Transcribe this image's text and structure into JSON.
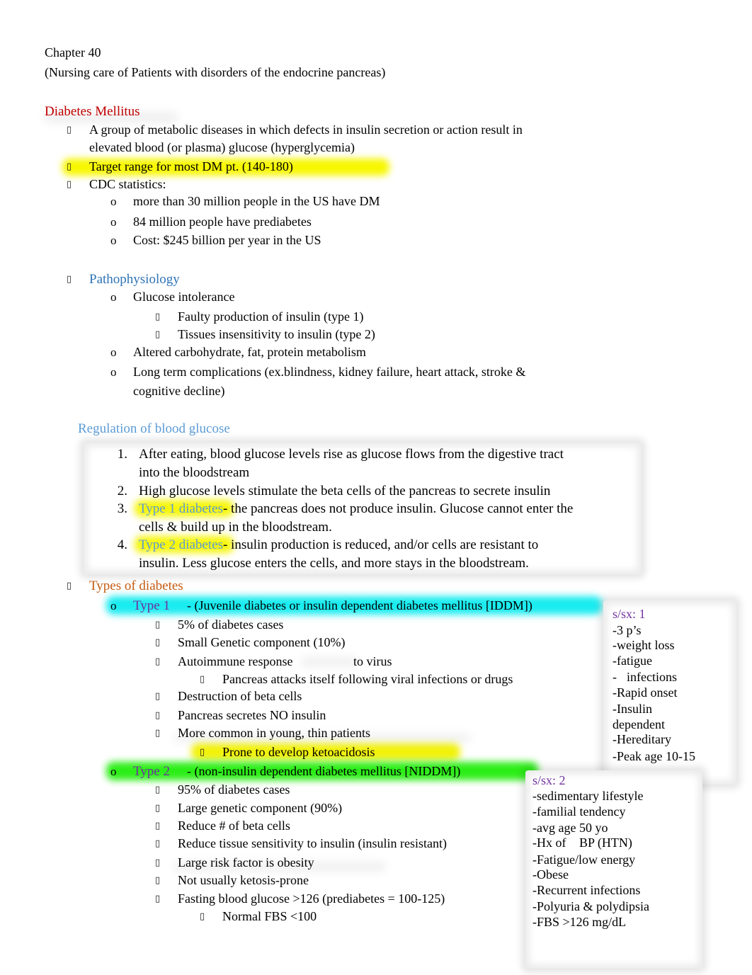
{
  "header": {
    "chapter": "Chapter 40",
    "subtitle": "(Nursing care of Patients with disorders of the endocrine pancreas)"
  },
  "dm": {
    "heading": "Diabetes Mellitus",
    "bullets": [
      {
        "line1": "A group of metabolic diseases in which defects in insulin secretion or action result in",
        "line2": "elevated blood (or plasma) glucose (hyperglycemia)"
      },
      {
        "line1": "Target range for most DM pt. (140-180)"
      },
      {
        "line1": "CDC statistics:"
      }
    ],
    "cdc": [
      "more than 30 million people in the US have DM",
      "84 million people have prediabetes",
      "Cost: $245 billion per year in the US"
    ]
  },
  "patho": {
    "heading": "Pathophysiology",
    "items": [
      {
        "text": "Glucose intolerance",
        "sub": [
          "Faulty production of insulin (type 1)",
          "Tissues insensitivity to insulin (type 2)"
        ]
      },
      {
        "text": "Altered carbohydrate, fat, protein metabolism"
      },
      {
        "text": "Long term complications (ex.blindness, kidney failure, heart attack, stroke &",
        "text2": "cognitive decline)"
      }
    ]
  },
  "regulation": {
    "heading": "Regulation of blood glucose",
    "items": [
      {
        "num": "1.",
        "l1": "After eating, blood glucose levels rise as glucose flows from the digestive tract",
        "l2": "into the bloodstream"
      },
      {
        "num": "2.",
        "l1": "High glucose levels stimulate the beta cells of the pancreas to secrete insulin"
      },
      {
        "num": "3.",
        "term": "Type 1 diabetes",
        "l1": "- the pancreas does not produce insulin. Glucose cannot enter the",
        "l2": "cells & build up in the bloodstream."
      },
      {
        "num": "4.",
        "term": "Type 2 diabetes",
        "l1": "- insulin production is reduced, and/or cells are resistant to",
        "l2": "insulin. Less glucose enters the cells, and more stays in the bloodstream."
      }
    ]
  },
  "types": {
    "heading": "Types of diabetes",
    "type1": {
      "label": "Type 1",
      "desc": "- (Juvenile diabetes or insulin dependent diabetes mellitus [IDDM])",
      "items": [
        "5% of diabetes cases",
        "Small Genetic component (10%)",
        "Autoimmune response",
        "Destruction of beta cells",
        "Pancreas secretes NO insulin",
        "More common in young, thin patients"
      ],
      "autoimmune_suffix": "to virus",
      "autoimmune_sub": "Pancreas attacks itself following viral infections or drugs",
      "young_sub": "Prone to develop ketoacidosis"
    },
    "type2": {
      "label": "Type 2",
      "desc": "- (non-insulin dependent diabetes mellitus [NIDDM])",
      "items": [
        "95% of diabetes cases",
        "Large genetic component (90%)",
        "Reduce # of beta cells",
        "Reduce tissue sensitivity to insulin (insulin resistant)",
        "Large risk factor is obesity",
        "Not usually ketosis-prone",
        "Fasting blood glucose >126 (prediabetes = 100-125)"
      ],
      "fbs_sub": "Normal FBS <100"
    }
  },
  "sidebox1": {
    "title": "s/sx: 1",
    "lines": [
      "-3 p’s",
      "-weight loss",
      "-fatigue",
      "-infections",
      "-Rapid onset",
      "-Insulin",
      "dependent",
      "-Hereditary",
      "-Peak age 10-15"
    ]
  },
  "sidebox2": {
    "title": "s/sx: 2",
    "lines": [
      "-sedimentary lifestyle",
      "-familial tendency",
      "-avg age 50 yo",
      "-Hx of  BP (HTN)",
      "-Fatigue/low energy",
      "-Obese",
      "-Recurrent infections",
      "-Polyuria & polydipsia",
      "-FBS >126 mg/dL"
    ]
  },
  "glyphs": {
    "square_bullet": "▯",
    "circle_bullet": "o"
  },
  "colors": {
    "dm_heading": "#c00000",
    "patho_heading": "#2e74b5",
    "regulation_heading": "#5b9bd5",
    "types_heading": "#c55a11",
    "type_label": "#7030a0",
    "highlight_yellow": "#ffff00",
    "highlight_cyan": "#00ffff",
    "highlight_green": "#00ff00"
  }
}
